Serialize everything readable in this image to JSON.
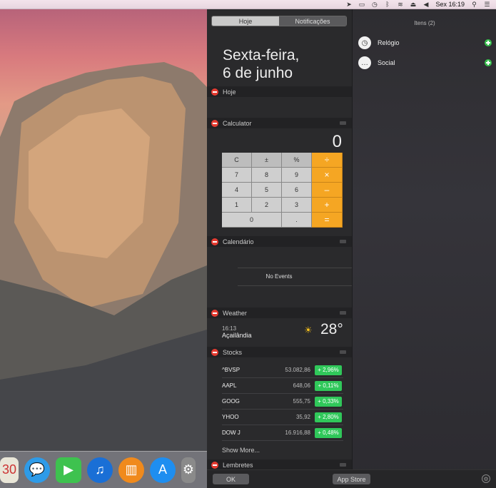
{
  "menubar": {
    "clock": "Sex 16:19",
    "icons": [
      "location-icon",
      "airplay-icon",
      "time-machine-icon",
      "bluetooth-icon",
      "wifi-icon",
      "eject-icon",
      "volume-icon",
      "spotlight-icon",
      "notification-center-icon"
    ]
  },
  "nc": {
    "tabs": {
      "today": "Hoje",
      "notifications": "Notificações"
    },
    "date_line1": "Sexta-feira,",
    "date_line2": "6 de junho",
    "widgets": {
      "hoje": "Hoje",
      "calculator": "Calculator",
      "calendar": "Calendário",
      "weather": "Weather",
      "stocks": "Stocks",
      "reminders": "Lembretes"
    },
    "calculator": {
      "display": "0",
      "keys": [
        "C",
        "±",
        "%",
        "÷",
        "7",
        "8",
        "9",
        "×",
        "4",
        "5",
        "6",
        "–",
        "1",
        "2",
        "3",
        "+",
        "0",
        ".",
        "="
      ]
    },
    "calendar": {
      "empty": "No Events"
    },
    "weather": {
      "time": "16:13",
      "city": "Açailândia",
      "temp": "28°",
      "icon": "sun-icon"
    },
    "stocks": [
      {
        "symbol": "^BVSP",
        "value": "53.082,86",
        "change": "+ 2,96%"
      },
      {
        "symbol": "AAPL",
        "value": "648,06",
        "change": "+ 0,11%"
      },
      {
        "symbol": "GOOG",
        "value": "555,75",
        "change": "+ 0,33%"
      },
      {
        "symbol": "YHOO",
        "value": "35,92",
        "change": "+ 2,80%"
      },
      {
        "symbol": "DOW J",
        "value": "16.916,88",
        "change": "+ 0,48%"
      }
    ],
    "show_more": "Show More...",
    "ok": "OK",
    "app_store": "App Store"
  },
  "items": {
    "title": "Itens (2)",
    "list": [
      {
        "label": "Relógio",
        "icon": "clock-icon"
      },
      {
        "label": "Social",
        "icon": "speech-bubble-icon"
      }
    ]
  },
  "colors": {
    "delete": "#e53b31",
    "add": "#3ac04f",
    "stock_up": "#30c85a",
    "calc_operator": "#f5a623"
  }
}
